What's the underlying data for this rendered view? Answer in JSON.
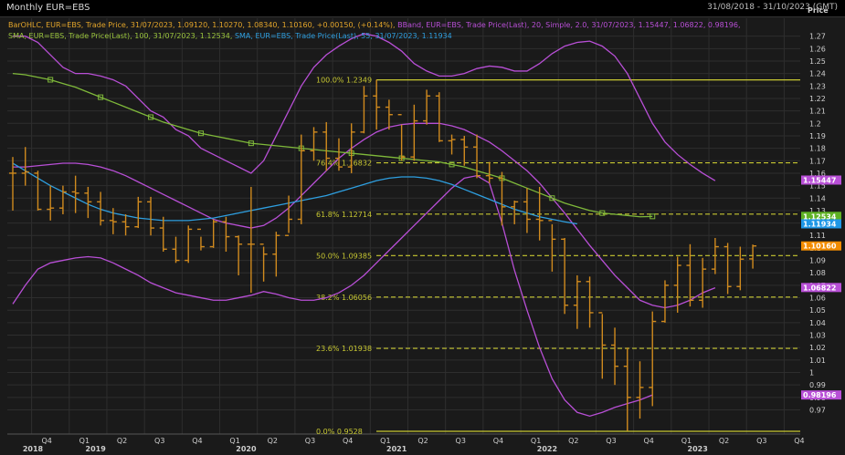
{
  "header": {
    "title": "Monthly EUR=EBS",
    "date_range": "31/08/2018 - 31/10/2023 (GMT)"
  },
  "legend": {
    "line1": [
      {
        "text": "BarOHLC, EUR=EBS, Trade Price, 31/07/2023, 1.09120, 1.10270, 1.08340, 1.10160, +0.00150, (+0.14%), ",
        "color": "#e3a52a"
      },
      {
        "text": "BBand, EUR=EBS, Trade Price(Last), 20, Simple, 2.0, 31/07/2023, 1.15447, 1.06822, 0.98196,",
        "color": "#b84fd6"
      }
    ],
    "line2": [
      {
        "text": "SMA, EUR=EBS, Trade Price(Last), 100, 31/07/2023, 1.12534, ",
        "color": "#9bc53d"
      },
      {
        "text": "SMA, EUR=EBS, Trade Price(Last), 55, 31/07/2023, 1.11934",
        "color": "#2e9fe0"
      }
    ]
  },
  "colors": {
    "background": "#1a1a1a",
    "grid": "#2e2e2e",
    "bars": "#d08a1e",
    "bband": "#b84fd6",
    "sma100": "#7fb93a",
    "sma55": "#2e9fe0",
    "fib": "#c8c832",
    "last_price_badge": "#f28c00",
    "sma100_badge": "#5fb224",
    "sma55_badge": "#1f97e6"
  },
  "chart_data": {
    "type": "ohlc",
    "title": "Monthly EUR=EBS",
    "y_axis_label": "Price",
    "ylim": [
      0.955,
      1.28
    ],
    "y_ticks": [
      0.97,
      0.98,
      0.99,
      1,
      1.01,
      1.02,
      1.03,
      1.04,
      1.05,
      1.06,
      1.07,
      1.08,
      1.09,
      1.1,
      1.11,
      1.12,
      1.13,
      1.14,
      1.15,
      1.16,
      1.17,
      1.18,
      1.19,
      1.2,
      1.21,
      1.22,
      1.23,
      1.24,
      1.25,
      1.26,
      1.27
    ],
    "y_tick_labels": [
      "0.97",
      "0.98",
      "0.99",
      "1",
      "1.01",
      "1.02",
      "1.03",
      "1.04",
      "1.05",
      "1.06",
      "1.07",
      "1.08",
      "1.09",
      "1.1",
      "1.11",
      "1.12",
      "1.13",
      "1.14",
      "1.15",
      "1.16",
      "1.17",
      "1.18",
      "1.19",
      "1.2",
      "1.21",
      "1.22",
      "1.23",
      "1.24",
      "1.25",
      "1.26",
      "1.27"
    ],
    "x_quarter_labels": [
      "Q4",
      "Q1",
      "Q2",
      "Q3",
      "Q4",
      "Q1",
      "Q2",
      "Q3",
      "Q4",
      "Q1",
      "Q2",
      "Q3",
      "Q4",
      "Q1",
      "Q2",
      "Q3",
      "Q4",
      "Q1",
      "Q2",
      "Q3",
      "Q4"
    ],
    "x_year_labels": [
      "2018",
      "2019",
      "2020",
      "2021",
      "2022",
      "2023"
    ],
    "start_month": "2018-08",
    "bars": [
      {
        "date": "2018-08",
        "o": 1.16,
        "h": 1.173,
        "l": 1.13,
        "c": 1.16
      },
      {
        "date": "2018-09",
        "o": 1.16,
        "h": 1.181,
        "l": 1.15,
        "c": 1.161
      },
      {
        "date": "2018-10",
        "o": 1.16,
        "h": 1.162,
        "l": 1.13,
        "c": 1.131
      },
      {
        "date": "2018-11",
        "o": 1.131,
        "h": 1.15,
        "l": 1.122,
        "c": 1.132
      },
      {
        "date": "2018-12",
        "o": 1.132,
        "h": 1.15,
        "l": 1.127,
        "c": 1.145
      },
      {
        "date": "2019-01",
        "o": 1.145,
        "h": 1.158,
        "l": 1.128,
        "c": 1.144
      },
      {
        "date": "2019-02",
        "o": 1.144,
        "h": 1.149,
        "l": 1.124,
        "c": 1.137
      },
      {
        "date": "2019-03",
        "o": 1.137,
        "h": 1.145,
        "l": 1.118,
        "c": 1.122
      },
      {
        "date": "2019-04",
        "o": 1.122,
        "h": 1.132,
        "l": 1.111,
        "c": 1.121
      },
      {
        "date": "2019-05",
        "o": 1.121,
        "h": 1.127,
        "l": 1.11,
        "c": 1.117
      },
      {
        "date": "2019-06",
        "o": 1.117,
        "h": 1.141,
        "l": 1.116,
        "c": 1.137
      },
      {
        "date": "2019-07",
        "o": 1.137,
        "h": 1.141,
        "l": 1.11,
        "c": 1.116
      },
      {
        "date": "2019-08",
        "o": 1.116,
        "h": 1.125,
        "l": 1.097,
        "c": 1.099
      },
      {
        "date": "2019-09",
        "o": 1.099,
        "h": 1.109,
        "l": 1.088,
        "c": 1.09
      },
      {
        "date": "2019-10",
        "o": 1.09,
        "h": 1.118,
        "l": 1.088,
        "c": 1.115
      },
      {
        "date": "2019-11",
        "o": 1.115,
        "h": 1.109,
        "l": 1.098,
        "c": 1.101
      },
      {
        "date": "2019-12",
        "o": 1.101,
        "h": 1.123,
        "l": 1.1,
        "c": 1.121
      },
      {
        "date": "2020-01",
        "o": 1.121,
        "h": 1.125,
        "l": 1.097,
        "c": 1.109
      },
      {
        "date": "2020-02",
        "o": 1.109,
        "h": 1.11,
        "l": 1.078,
        "c": 1.103
      },
      {
        "date": "2020-03",
        "o": 1.103,
        "h": 1.149,
        "l": 1.064,
        "c": 1.103
      },
      {
        "date": "2020-04",
        "o": 1.103,
        "h": 1.101,
        "l": 1.073,
        "c": 1.095
      },
      {
        "date": "2020-05",
        "o": 1.095,
        "h": 1.113,
        "l": 1.077,
        "c": 1.11
      },
      {
        "date": "2020-06",
        "o": 1.11,
        "h": 1.142,
        "l": 1.112,
        "c": 1.123
      },
      {
        "date": "2020-07",
        "o": 1.123,
        "h": 1.191,
        "l": 1.119,
        "c": 1.178
      },
      {
        "date": "2020-08",
        "o": 1.178,
        "h": 1.197,
        "l": 1.17,
        "c": 1.193
      },
      {
        "date": "2020-09",
        "o": 1.193,
        "h": 1.201,
        "l": 1.162,
        "c": 1.172
      },
      {
        "date": "2020-10",
        "o": 1.172,
        "h": 1.188,
        "l": 1.162,
        "c": 1.165
      },
      {
        "date": "2020-11",
        "o": 1.165,
        "h": 1.2,
        "l": 1.16,
        "c": 1.193
      },
      {
        "date": "2020-12",
        "o": 1.193,
        "h": 1.23,
        "l": 1.192,
        "c": 1.222
      },
      {
        "date": "2021-01",
        "o": 1.222,
        "h": 1.235,
        "l": 1.195,
        "c": 1.213
      },
      {
        "date": "2021-02",
        "o": 1.213,
        "h": 1.219,
        "l": 1.195,
        "c": 1.207
      },
      {
        "date": "2021-03",
        "o": 1.207,
        "h": 1.199,
        "l": 1.17,
        "c": 1.173
      },
      {
        "date": "2021-04",
        "o": 1.173,
        "h": 1.215,
        "l": 1.17,
        "c": 1.202
      },
      {
        "date": "2021-05",
        "o": 1.202,
        "h": 1.227,
        "l": 1.199,
        "c": 1.222
      },
      {
        "date": "2021-06",
        "o": 1.222,
        "h": 1.225,
        "l": 1.185,
        "c": 1.186
      },
      {
        "date": "2021-07",
        "o": 1.186,
        "h": 1.191,
        "l": 1.175,
        "c": 1.187
      },
      {
        "date": "2021-08",
        "o": 1.187,
        "h": 1.19,
        "l": 1.166,
        "c": 1.181
      },
      {
        "date": "2021-09",
        "o": 1.181,
        "h": 1.191,
        "l": 1.156,
        "c": 1.158
      },
      {
        "date": "2021-10",
        "o": 1.158,
        "h": 1.169,
        "l": 1.152,
        "c": 1.156
      },
      {
        "date": "2021-11",
        "o": 1.156,
        "h": 1.161,
        "l": 1.118,
        "c": 1.133
      },
      {
        "date": "2021-12",
        "o": 1.133,
        "h": 1.138,
        "l": 1.119,
        "c": 1.137
      },
      {
        "date": "2022-01",
        "o": 1.137,
        "h": 1.148,
        "l": 1.112,
        "c": 1.123
      },
      {
        "date": "2022-02",
        "o": 1.123,
        "h": 1.149,
        "l": 1.106,
        "c": 1.122
      },
      {
        "date": "2022-03",
        "o": 1.122,
        "h": 1.119,
        "l": 1.081,
        "c": 1.107
      },
      {
        "date": "2022-04",
        "o": 1.107,
        "h": 1.108,
        "l": 1.047,
        "c": 1.054
      },
      {
        "date": "2022-05",
        "o": 1.054,
        "h": 1.078,
        "l": 1.035,
        "c": 1.073
      },
      {
        "date": "2022-06",
        "o": 1.073,
        "h": 1.077,
        "l": 1.036,
        "c": 1.048
      },
      {
        "date": "2022-07",
        "o": 1.048,
        "h": 1.047,
        "l": 0.995,
        "c": 1.022
      },
      {
        "date": "2022-08",
        "o": 1.022,
        "h": 1.036,
        "l": 0.99,
        "c": 1.005
      },
      {
        "date": "2022-09",
        "o": 1.005,
        "h": 1.02,
        "l": 0.953,
        "c": 0.98
      },
      {
        "date": "2022-10",
        "o": 0.98,
        "h": 1.009,
        "l": 0.963,
        "c": 0.988
      },
      {
        "date": "2022-11",
        "o": 0.988,
        "h": 1.049,
        "l": 0.973,
        "c": 1.041
      },
      {
        "date": "2022-12",
        "o": 1.041,
        "h": 1.074,
        "l": 1.04,
        "c": 1.07
      },
      {
        "date": "2023-01",
        "o": 1.07,
        "h": 1.093,
        "l": 1.048,
        "c": 1.086
      },
      {
        "date": "2023-02",
        "o": 1.086,
        "h": 1.103,
        "l": 1.053,
        "c": 1.058
      },
      {
        "date": "2023-03",
        "o": 1.058,
        "h": 1.092,
        "l": 1.052,
        "c": 1.083
      },
      {
        "date": "2023-04",
        "o": 1.083,
        "h": 1.108,
        "l": 1.079,
        "c": 1.101
      },
      {
        "date": "2023-05",
        "o": 1.101,
        "h": 1.104,
        "l": 1.063,
        "c": 1.069
      },
      {
        "date": "2023-06",
        "o": 1.069,
        "h": 1.101,
        "l": 1.066,
        "c": 1.091
      },
      {
        "date": "2023-07",
        "o": 1.0912,
        "h": 1.1027,
        "l": 1.0834,
        "c": 1.1016
      }
    ],
    "series": [
      {
        "name": "BBand Upper",
        "color": "#b84fd6",
        "values": [
          1.27,
          1.27,
          1.265,
          1.255,
          1.245,
          1.24,
          1.24,
          1.238,
          1.235,
          1.23,
          1.22,
          1.21,
          1.205,
          1.195,
          1.19,
          1.18,
          1.175,
          1.17,
          1.165,
          1.16,
          1.17,
          1.19,
          1.21,
          1.23,
          1.245,
          1.255,
          1.262,
          1.268,
          1.272,
          1.27,
          1.265,
          1.258,
          1.248,
          1.242,
          1.238,
          1.238,
          1.24,
          1.244,
          1.246,
          1.245,
          1.242,
          1.242,
          1.248,
          1.256,
          1.262,
          1.265,
          1.266,
          1.262,
          1.254,
          1.24,
          1.22,
          1.2,
          1.185,
          1.175,
          1.167,
          1.16,
          1.154
        ]
      },
      {
        "name": "BBand Middle",
        "color": "#b84fd6",
        "values": [
          1.165,
          1.165,
          1.166,
          1.167,
          1.168,
          1.168,
          1.167,
          1.165,
          1.162,
          1.158,
          1.153,
          1.148,
          1.143,
          1.138,
          1.133,
          1.128,
          1.123,
          1.12,
          1.118,
          1.116,
          1.118,
          1.124,
          1.132,
          1.142,
          1.152,
          1.162,
          1.172,
          1.18,
          1.187,
          1.193,
          1.197,
          1.199,
          1.2,
          1.2,
          1.2,
          1.198,
          1.195,
          1.19,
          1.185,
          1.178,
          1.17,
          1.162,
          1.152,
          1.14,
          1.128,
          1.115,
          1.102,
          1.09,
          1.078,
          1.068,
          1.058,
          1.054,
          1.052,
          1.054,
          1.058,
          1.064,
          1.068
        ]
      },
      {
        "name": "BBand Lower",
        "color": "#b84fd6",
        "values": [
          1.055,
          1.07,
          1.083,
          1.088,
          1.09,
          1.092,
          1.093,
          1.092,
          1.088,
          1.083,
          1.078,
          1.072,
          1.068,
          1.064,
          1.062,
          1.06,
          1.058,
          1.058,
          1.06,
          1.062,
          1.065,
          1.063,
          1.06,
          1.058,
          1.058,
          1.06,
          1.064,
          1.07,
          1.078,
          1.088,
          1.098,
          1.108,
          1.118,
          1.128,
          1.138,
          1.148,
          1.156,
          1.158,
          1.152,
          1.12,
          1.082,
          1.05,
          1.02,
          0.995,
          0.978,
          0.968,
          0.965,
          0.968,
          0.972,
          0.975,
          0.978,
          0.982
        ]
      },
      {
        "name": "SMA 100",
        "color": "#7fb93a",
        "values": [
          1.24,
          1.239,
          1.237,
          1.235,
          1.232,
          1.229,
          1.225,
          1.221,
          1.217,
          1.213,
          1.209,
          1.205,
          1.201,
          1.198,
          1.195,
          1.192,
          1.19,
          1.188,
          1.186,
          1.184,
          1.183,
          1.182,
          1.181,
          1.18,
          1.179,
          1.178,
          1.177,
          1.176,
          1.175,
          1.174,
          1.173,
          1.172,
          1.171,
          1.17,
          1.169,
          1.167,
          1.165,
          1.162,
          1.159,
          1.156,
          1.152,
          1.148,
          1.144,
          1.14,
          1.136,
          1.133,
          1.13,
          1.128,
          1.127,
          1.126,
          1.125,
          1.1253
        ]
      },
      {
        "name": "SMA 55",
        "color": "#2e9fe0",
        "values": [
          1.168,
          1.162,
          1.156,
          1.15,
          1.145,
          1.14,
          1.135,
          1.131,
          1.128,
          1.126,
          1.124,
          1.123,
          1.122,
          1.122,
          1.122,
          1.123,
          1.124,
          1.126,
          1.128,
          1.13,
          1.132,
          1.134,
          1.136,
          1.138,
          1.14,
          1.142,
          1.145,
          1.148,
          1.151,
          1.154,
          1.156,
          1.157,
          1.157,
          1.156,
          1.154,
          1.151,
          1.147,
          1.143,
          1.139,
          1.135,
          1.131,
          1.128,
          1.125,
          1.123,
          1.121,
          1.1193
        ]
      }
    ],
    "fib_levels": [
      {
        "label": "100.0%",
        "value": 1.2349,
        "text": "1.2349"
      },
      {
        "label": "76.4%",
        "value": 1.16832,
        "text": "1.16832"
      },
      {
        "label": "61.8%",
        "value": 1.12714,
        "text": "1.12714"
      },
      {
        "label": "50.0%",
        "value": 1.09385,
        "text": "1.09385"
      },
      {
        "label": "38.2%",
        "value": 1.06056,
        "text": "1.06056"
      },
      {
        "label": "23.6%",
        "value": 1.01938,
        "text": "1.01938"
      },
      {
        "label": "0.0%",
        "value": 0.9528,
        "text": "0.9528"
      }
    ],
    "price_badges": [
      {
        "text": "1.15447",
        "value": 1.15447,
        "color": "#b84fd6"
      },
      {
        "text": "1.12534",
        "value": 1.12534,
        "color": "#5fb224"
      },
      {
        "text": "1.11934",
        "value": 1.11934,
        "color": "#1f97e6"
      },
      {
        "text": "1.10160",
        "value": 1.1016,
        "color": "#f28c00"
      },
      {
        "text": "1.06822",
        "value": 1.06822,
        "color": "#b84fd6"
      },
      {
        "text": "0.98196",
        "value": 0.98196,
        "color": "#b84fd6"
      }
    ],
    "grid": true,
    "legend": "top-left"
  }
}
